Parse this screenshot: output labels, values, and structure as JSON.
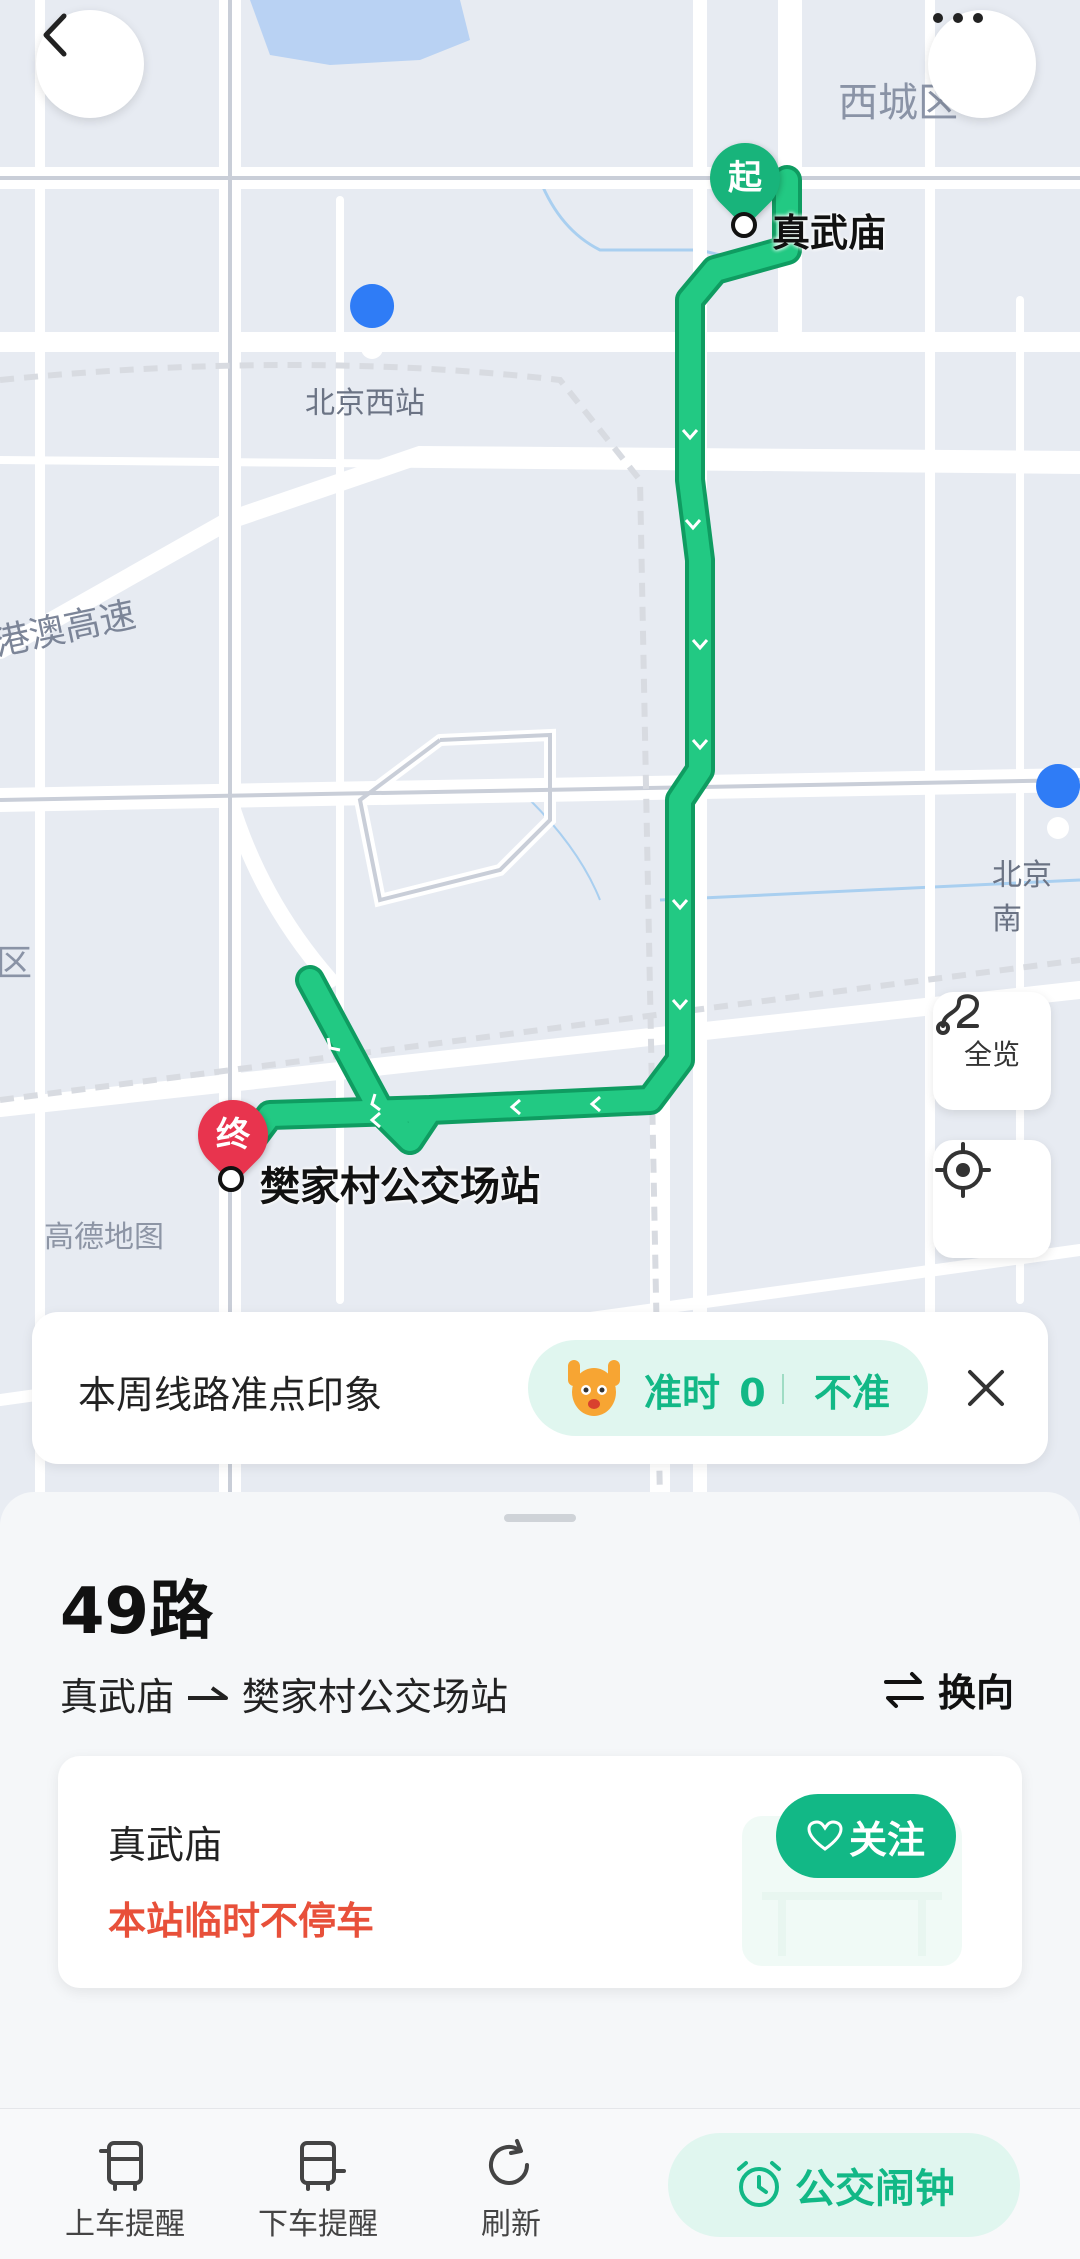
{
  "map": {
    "labels": {
      "district_xicheng": "西城区",
      "station_beijing_west": "北京西站",
      "expressway": "港澳高速",
      "station_beijing_south": "北京南",
      "district_left": "区",
      "watermark": "高德地图"
    },
    "start_marker": "起",
    "end_marker": "终",
    "start_stop": "真武庙",
    "end_stop": "樊家村公交场站",
    "overview_label": "全览",
    "route_color": "#1fc07a"
  },
  "punctuality": {
    "title": "本周线路准点印象",
    "on_time_label": "准时",
    "on_time_count": "0",
    "late_label": "不准"
  },
  "route": {
    "name": "49路",
    "from": "真武庙",
    "to": "樊家村公交场站",
    "reverse_label": "换向"
  },
  "stop_card": {
    "stop_name": "真武庙",
    "status": "本站临时不停车",
    "follow_label": "关注"
  },
  "bottom_bar": {
    "board_reminder": "上车提醒",
    "alight_reminder": "下车提醒",
    "refresh": "刷新",
    "bus_alarm": "公交闹钟"
  },
  "colors": {
    "accent": "#12b886",
    "warning_red": "#e8503a",
    "end_marker": "#e8344e"
  }
}
